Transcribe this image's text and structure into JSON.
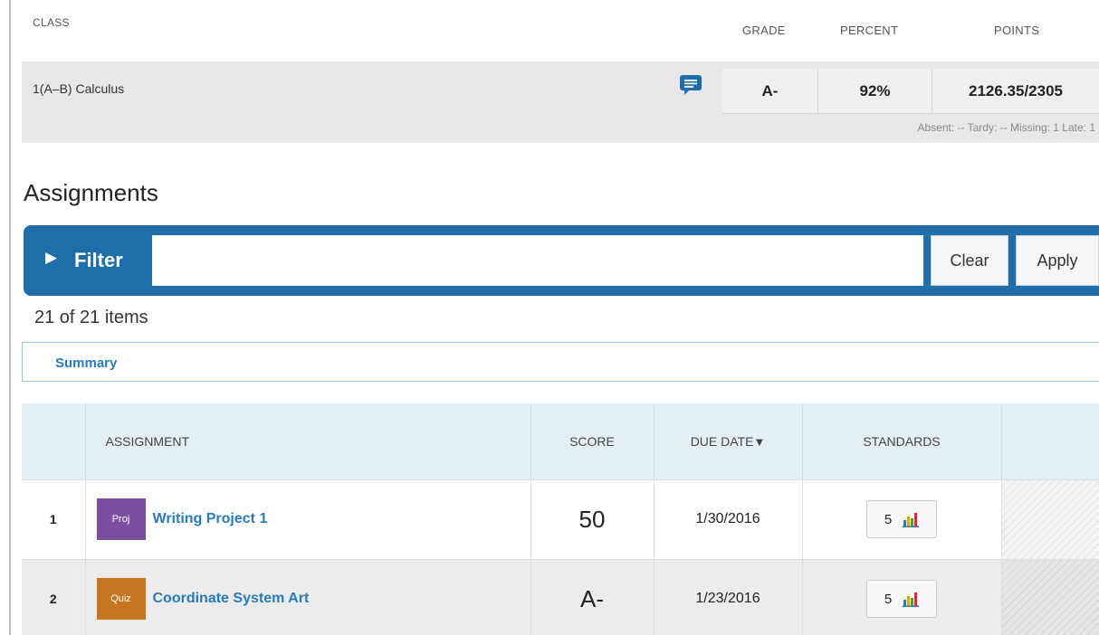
{
  "class_summary": {
    "headers": {
      "class": "CLASS",
      "grade": "GRADE",
      "percent": "PERCENT",
      "points": "POINTS"
    },
    "class_name": "1(A–B) Calculus",
    "grade": "A-",
    "percent": "92%",
    "points": "2126.35/2305",
    "attendance": "Absent: -- Tardy: -- Missing: 1 Late: 1",
    "comment_icon": "comment-icon"
  },
  "assignments": {
    "title": "Assignments",
    "filter": {
      "toggle_icon": "▶",
      "label": "Filter",
      "value": "",
      "clear_label": "Clear",
      "apply_label": "Apply"
    },
    "item_count": "21 of 21 items",
    "summary_tab": "Summary",
    "table": {
      "columns": {
        "num": "",
        "assignment": "ASSIGNMENT",
        "score": "SCORE",
        "due_date": "DUE DATE",
        "sort_icon": "▼",
        "standards": "STANDARDS",
        "extra": ""
      },
      "rows": [
        {
          "num": "1",
          "category": "Proj",
          "category_color": "#7b4fa0",
          "name": "Writing Project 1",
          "score": "50",
          "due_date": "1/30/2016",
          "standards": "5"
        },
        {
          "num": "2",
          "category": "Quiz",
          "category_color": "#c7761f",
          "name": "Coordinate System Art",
          "score": "A-",
          "due_date": "1/23/2016",
          "standards": "5"
        }
      ]
    }
  },
  "colors": {
    "accent": "#1f6ea9",
    "link": "#2a7ab8"
  }
}
